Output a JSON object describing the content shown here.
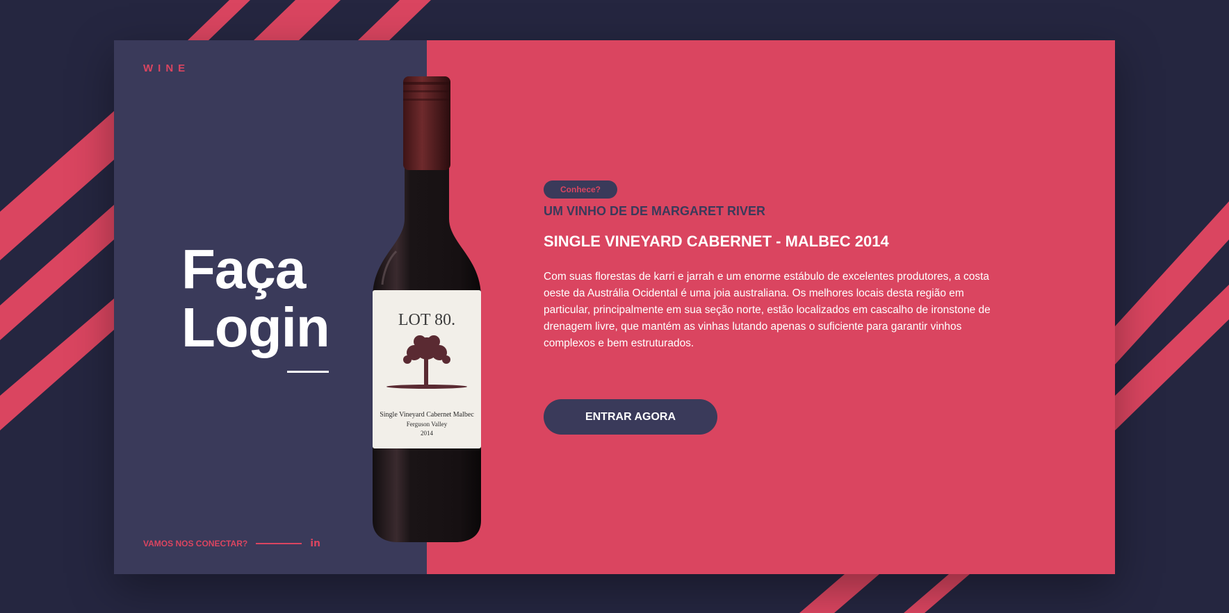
{
  "brand": "WINE",
  "hero": {
    "line1": "Faça",
    "line2": "Login"
  },
  "footer": {
    "connect_label": "VAMOS NOS CONECTAR?",
    "linkedin_glyph": "in"
  },
  "bottle": {
    "label_line1": "LOT 80.",
    "label_line2": "Single Vineyard Cabernet Malbec",
    "label_line3": "Ferguson Valley",
    "label_line4": "2014"
  },
  "content": {
    "tag": "Conhece?",
    "subtitle": "UM VINHO DE DE MARGARET RIVER",
    "title": "SINGLE VINEYARD CABERNET - MALBEC 2014",
    "body": "Com suas florestas de karri e jarrah e um enorme estábulo de excelentes produtores, a costa oeste da Austrália Ocidental é uma joia australiana. Os melhores locais desta região em particular, principalmente em sua seção norte, estão localizados em cascalho de ironstone de drenagem livre, que mantém as vinhas lutando apenas o suficiente para garantir vinhos complexos e bem estruturados.",
    "cta": "ENTRAR AGORA"
  },
  "colors": {
    "background": "#252640",
    "accent": "#da4560",
    "panel_dark": "#3a3a5a",
    "white": "#ffffff"
  }
}
